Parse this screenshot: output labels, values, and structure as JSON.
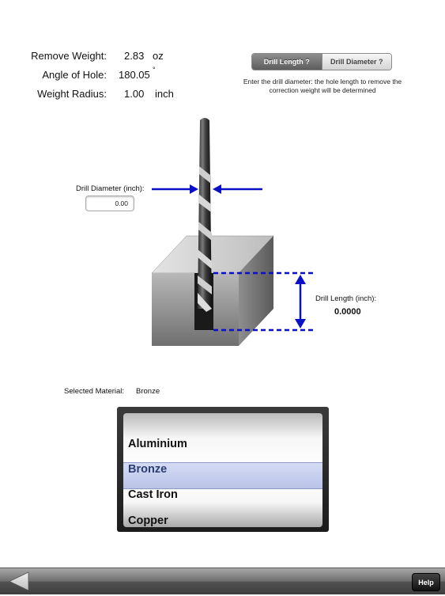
{
  "info": {
    "remove_weight": {
      "label": "Remove Weight:",
      "value": "2.83",
      "unit": "oz"
    },
    "angle_of_hole": {
      "label": "Angle of Hole:",
      "value": "180.05",
      "unit": "°"
    },
    "weight_radius": {
      "label": "Weight Radius:",
      "value": "1.00",
      "unit": "inch"
    }
  },
  "mode": {
    "options": [
      "Drill Length ?",
      "Drill Diameter ?"
    ],
    "selected": "Drill Length ?"
  },
  "instruction": "Enter the drill diameter: the hole length to remove the correction weight will be determined",
  "diagram": {
    "drill_diameter_label": "Drill Diameter (inch):",
    "drill_diameter_value": "0.00",
    "drill_length_label": "Drill Length (inch):",
    "drill_length_value": "0.0000",
    "arrow_color": "#0a10c8"
  },
  "material": {
    "label": "Selected Material:",
    "selected": "Bronze",
    "visible_options": [
      "Aluminium",
      "Bronze",
      "Cast Iron",
      "Copper"
    ]
  },
  "toolbar": {
    "back_icon": "triangle-left-icon",
    "help_label": "Help"
  }
}
